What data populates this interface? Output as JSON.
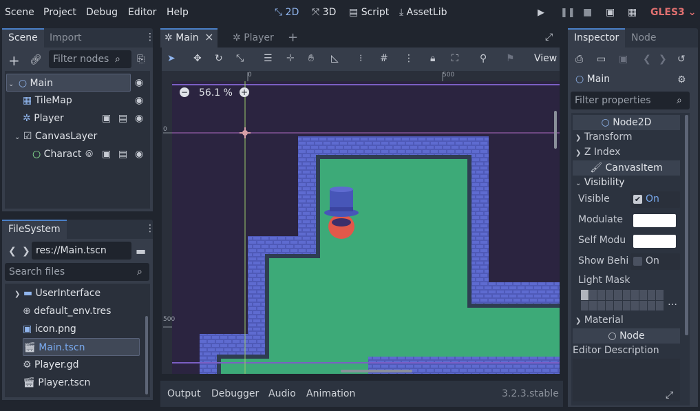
{
  "menu": [
    "Scene",
    "Project",
    "Debug",
    "Editor",
    "Help"
  ],
  "workspaces": [
    "2D",
    "3D",
    "Script",
    "AssetLib"
  ],
  "renderer": "GLES3",
  "scene_dock": {
    "tabs": [
      "Scene",
      "Import"
    ],
    "filter_placeholder": "Filter nodes",
    "nodes": [
      {
        "name": "Main"
      },
      {
        "name": "TileMap"
      },
      {
        "name": "Player"
      },
      {
        "name": "CanvasLayer"
      },
      {
        "name": "Charact"
      }
    ]
  },
  "filesystem": {
    "tab": "FileSystem",
    "path": "res://Main.tscn",
    "search_placeholder": "Search files",
    "items": [
      {
        "name": "UserInterface"
      },
      {
        "name": "default_env.tres"
      },
      {
        "name": "icon.png"
      },
      {
        "name": "Main.tscn"
      },
      {
        "name": "Player.gd"
      },
      {
        "name": "Player.tscn"
      }
    ]
  },
  "editor_tabs": [
    "Main",
    "Player"
  ],
  "toolbar": {
    "view_label": "View"
  },
  "viewport": {
    "zoom": "56.1 %",
    "ruler_top": [
      "0",
      "500"
    ],
    "ruler_left": [
      "0",
      "500"
    ]
  },
  "bottom_panel": {
    "tabs": [
      "Output",
      "Debugger",
      "Audio",
      "Animation"
    ],
    "version": "3.2.3.stable"
  },
  "inspector": {
    "tabs": [
      "Inspector",
      "Node"
    ],
    "node_name": "Main",
    "filter_placeholder": "Filter properties",
    "sections": {
      "node2d": "Node2D",
      "transform": "Transform",
      "zindex": "Z Index",
      "canvasitem": "CanvasItem",
      "visibility": "Visibility",
      "material": "Material",
      "node": "Node"
    },
    "props": {
      "visible_label": "Visible",
      "visible_value": "On",
      "modulate_label": "Modulate",
      "self_modulate_label": "Self Modu",
      "show_behind_label": "Show Behi",
      "show_behind_value": "On",
      "light_mask_label": "Light Mask",
      "editor_description_label": "Editor Description"
    }
  },
  "colors": {
    "accent": "#4a80c8",
    "renderer": "#e07070",
    "visible_on": "#78a8ec"
  }
}
